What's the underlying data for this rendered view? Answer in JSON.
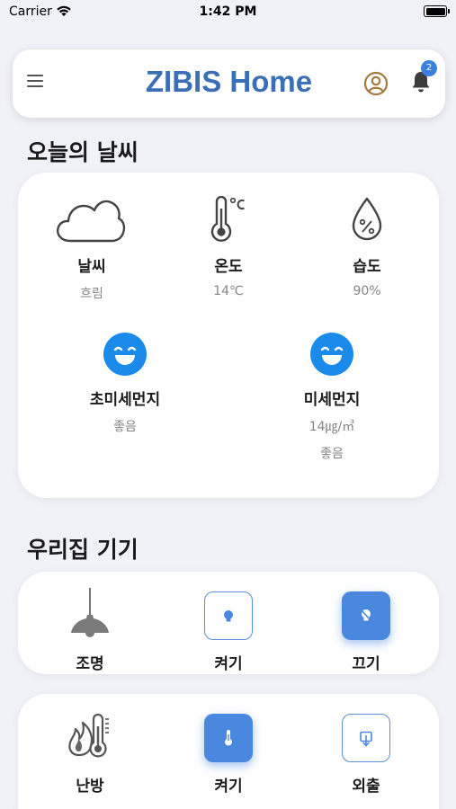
{
  "status_bar": {
    "carrier": "Carrier",
    "time": "1:42 PM"
  },
  "header": {
    "title": "ZIBIS Home",
    "notification_count": "2"
  },
  "weather": {
    "section_title": "오늘의 날씨",
    "items": [
      {
        "label": "날씨",
        "value": "흐림",
        "icon": "cloud-icon"
      },
      {
        "label": "온도",
        "value": "14℃",
        "icon": "thermometer-icon"
      },
      {
        "label": "습도",
        "value": "90%",
        "icon": "humidity-drop-icon"
      }
    ],
    "dust": [
      {
        "label": "초미세먼지",
        "value": "좋음",
        "icon": "smile-face-icon"
      },
      {
        "label": "미세먼지",
        "amount": "14㎍/㎥",
        "value": "좋음",
        "icon": "smile-face-icon"
      }
    ]
  },
  "devices": {
    "section_title": "우리집 기기",
    "lighting": {
      "name": "조명",
      "on_label": "켜기",
      "off_label": "끄기",
      "active": "off"
    },
    "heating": {
      "name": "난방",
      "on_label": "켜기",
      "away_label": "외출",
      "active": "on"
    }
  },
  "colors": {
    "brand": "#3a6fb5",
    "accent": "#4a88e0",
    "face": "#1a8aeb",
    "background": "#f1f1f8"
  }
}
